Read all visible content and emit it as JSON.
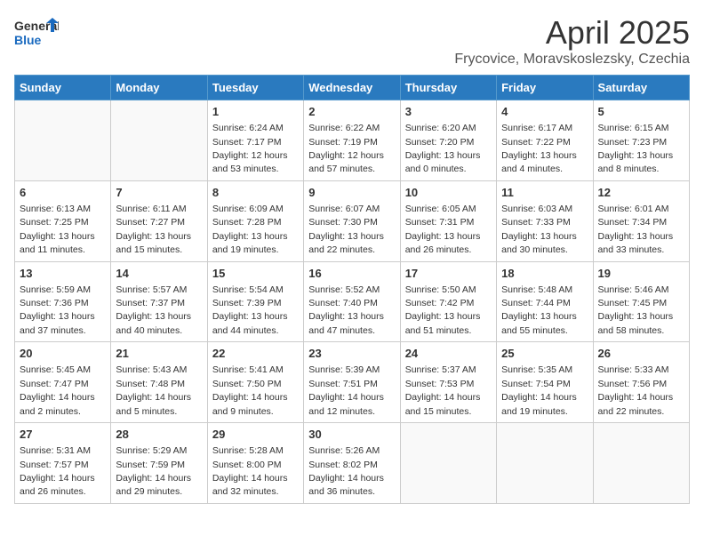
{
  "logo": {
    "general": "General",
    "blue": "Blue"
  },
  "title": "April 2025",
  "subtitle": "Frycovice, Moravskoslezsky, Czechia",
  "header_days": [
    "Sunday",
    "Monday",
    "Tuesday",
    "Wednesday",
    "Thursday",
    "Friday",
    "Saturday"
  ],
  "weeks": [
    [
      {
        "day": "",
        "info": ""
      },
      {
        "day": "",
        "info": ""
      },
      {
        "day": "1",
        "info": "Sunrise: 6:24 AM\nSunset: 7:17 PM\nDaylight: 12 hours and 53 minutes."
      },
      {
        "day": "2",
        "info": "Sunrise: 6:22 AM\nSunset: 7:19 PM\nDaylight: 12 hours and 57 minutes."
      },
      {
        "day": "3",
        "info": "Sunrise: 6:20 AM\nSunset: 7:20 PM\nDaylight: 13 hours and 0 minutes."
      },
      {
        "day": "4",
        "info": "Sunrise: 6:17 AM\nSunset: 7:22 PM\nDaylight: 13 hours and 4 minutes."
      },
      {
        "day": "5",
        "info": "Sunrise: 6:15 AM\nSunset: 7:23 PM\nDaylight: 13 hours and 8 minutes."
      }
    ],
    [
      {
        "day": "6",
        "info": "Sunrise: 6:13 AM\nSunset: 7:25 PM\nDaylight: 13 hours and 11 minutes."
      },
      {
        "day": "7",
        "info": "Sunrise: 6:11 AM\nSunset: 7:27 PM\nDaylight: 13 hours and 15 minutes."
      },
      {
        "day": "8",
        "info": "Sunrise: 6:09 AM\nSunset: 7:28 PM\nDaylight: 13 hours and 19 minutes."
      },
      {
        "day": "9",
        "info": "Sunrise: 6:07 AM\nSunset: 7:30 PM\nDaylight: 13 hours and 22 minutes."
      },
      {
        "day": "10",
        "info": "Sunrise: 6:05 AM\nSunset: 7:31 PM\nDaylight: 13 hours and 26 minutes."
      },
      {
        "day": "11",
        "info": "Sunrise: 6:03 AM\nSunset: 7:33 PM\nDaylight: 13 hours and 30 minutes."
      },
      {
        "day": "12",
        "info": "Sunrise: 6:01 AM\nSunset: 7:34 PM\nDaylight: 13 hours and 33 minutes."
      }
    ],
    [
      {
        "day": "13",
        "info": "Sunrise: 5:59 AM\nSunset: 7:36 PM\nDaylight: 13 hours and 37 minutes."
      },
      {
        "day": "14",
        "info": "Sunrise: 5:57 AM\nSunset: 7:37 PM\nDaylight: 13 hours and 40 minutes."
      },
      {
        "day": "15",
        "info": "Sunrise: 5:54 AM\nSunset: 7:39 PM\nDaylight: 13 hours and 44 minutes."
      },
      {
        "day": "16",
        "info": "Sunrise: 5:52 AM\nSunset: 7:40 PM\nDaylight: 13 hours and 47 minutes."
      },
      {
        "day": "17",
        "info": "Sunrise: 5:50 AM\nSunset: 7:42 PM\nDaylight: 13 hours and 51 minutes."
      },
      {
        "day": "18",
        "info": "Sunrise: 5:48 AM\nSunset: 7:44 PM\nDaylight: 13 hours and 55 minutes."
      },
      {
        "day": "19",
        "info": "Sunrise: 5:46 AM\nSunset: 7:45 PM\nDaylight: 13 hours and 58 minutes."
      }
    ],
    [
      {
        "day": "20",
        "info": "Sunrise: 5:45 AM\nSunset: 7:47 PM\nDaylight: 14 hours and 2 minutes."
      },
      {
        "day": "21",
        "info": "Sunrise: 5:43 AM\nSunset: 7:48 PM\nDaylight: 14 hours and 5 minutes."
      },
      {
        "day": "22",
        "info": "Sunrise: 5:41 AM\nSunset: 7:50 PM\nDaylight: 14 hours and 9 minutes."
      },
      {
        "day": "23",
        "info": "Sunrise: 5:39 AM\nSunset: 7:51 PM\nDaylight: 14 hours and 12 minutes."
      },
      {
        "day": "24",
        "info": "Sunrise: 5:37 AM\nSunset: 7:53 PM\nDaylight: 14 hours and 15 minutes."
      },
      {
        "day": "25",
        "info": "Sunrise: 5:35 AM\nSunset: 7:54 PM\nDaylight: 14 hours and 19 minutes."
      },
      {
        "day": "26",
        "info": "Sunrise: 5:33 AM\nSunset: 7:56 PM\nDaylight: 14 hours and 22 minutes."
      }
    ],
    [
      {
        "day": "27",
        "info": "Sunrise: 5:31 AM\nSunset: 7:57 PM\nDaylight: 14 hours and 26 minutes."
      },
      {
        "day": "28",
        "info": "Sunrise: 5:29 AM\nSunset: 7:59 PM\nDaylight: 14 hours and 29 minutes."
      },
      {
        "day": "29",
        "info": "Sunrise: 5:28 AM\nSunset: 8:00 PM\nDaylight: 14 hours and 32 minutes."
      },
      {
        "day": "30",
        "info": "Sunrise: 5:26 AM\nSunset: 8:02 PM\nDaylight: 14 hours and 36 minutes."
      },
      {
        "day": "",
        "info": ""
      },
      {
        "day": "",
        "info": ""
      },
      {
        "day": "",
        "info": ""
      }
    ]
  ]
}
